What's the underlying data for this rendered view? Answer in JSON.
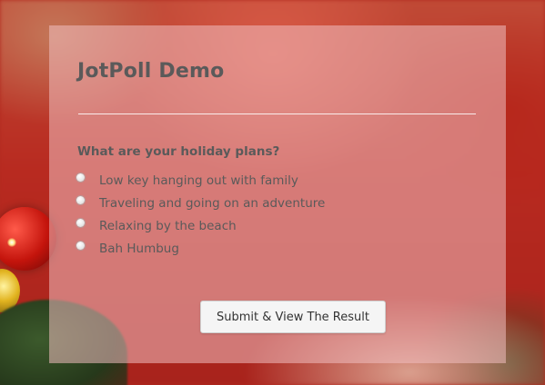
{
  "poll": {
    "title": "JotPoll Demo",
    "question": "What are your holiday plans?",
    "options": [
      {
        "label": "Low key hanging out with family",
        "selected": false
      },
      {
        "label": "Traveling and going on an adventure",
        "selected": false
      },
      {
        "label": "Relaxing by the beach",
        "selected": false
      },
      {
        "label": "Bah Humbug",
        "selected": false
      }
    ],
    "submit_label": "Submit & View The Result"
  },
  "colors": {
    "text": "#5a5a5a",
    "panel": "rgba(240,190,192,0.55)",
    "background": "#b32a1f",
    "button_bg": "#f5f5f5"
  }
}
